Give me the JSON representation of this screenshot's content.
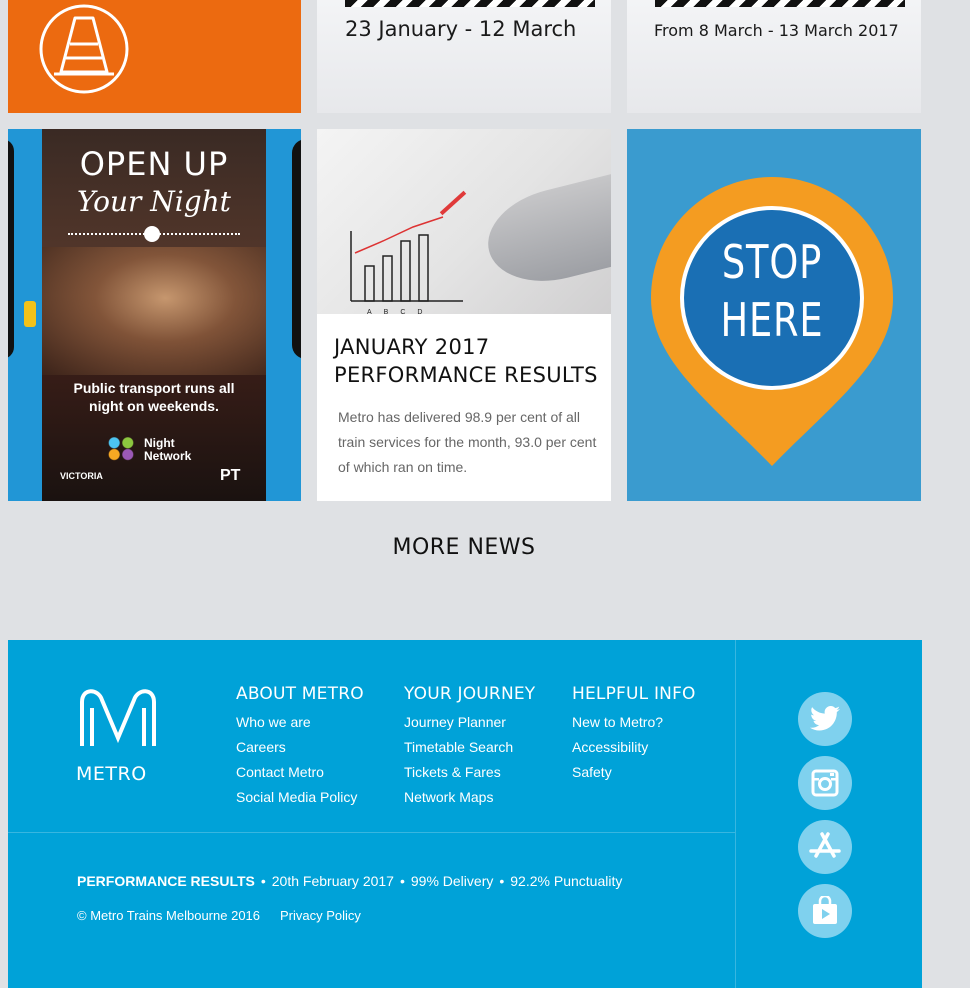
{
  "tiles": {
    "closure_a": {
      "dates": "23 January - 12 March"
    },
    "closure_b": {
      "dates": "From 8 March - 13 March 2017"
    },
    "night_network": {
      "headline_line1": "OPEN UP",
      "headline_line2": "Your Night",
      "tagline": "Public transport runs all night on weekends.",
      "badge": "Night Network",
      "victoria": "VICTORIA",
      "ptv": "PT"
    },
    "performance": {
      "title_line1": "JANUARY 2017",
      "title_line2": "PERFORMANCE RESULTS",
      "body": "Metro has delivered 98.9 per cent of all train services for the month, 93.0 per cent of which ran on time.",
      "chart_labels": [
        "A",
        "B",
        "C",
        "D"
      ]
    },
    "stop_here": {
      "line1": "STOP",
      "line2": "HERE"
    }
  },
  "more_news_label": "MORE NEWS",
  "footer": {
    "logo_text": "METRO",
    "columns": [
      {
        "heading": "ABOUT METRO",
        "links": [
          "Who we are",
          "Careers",
          "Contact Metro",
          "Social Media Policy"
        ]
      },
      {
        "heading": "YOUR JOURNEY",
        "links": [
          "Journey Planner",
          "Timetable Search",
          "Tickets & Fares",
          "Network Maps"
        ]
      },
      {
        "heading": "HELPFUL INFO",
        "links": [
          "New to Metro?",
          "Accessibility",
          "Safety"
        ]
      }
    ],
    "performance": {
      "label": "PERFORMANCE RESULTS",
      "date": "20th February 2017",
      "delivery": "99% Delivery",
      "punctuality": "92.2% Punctuality"
    },
    "copyright": "© Metro Trains Melbourne 2016",
    "privacy": "Privacy Policy",
    "social_icons": [
      "twitter-icon",
      "instagram-icon",
      "app-store-icon",
      "google-play-icon"
    ]
  },
  "colors": {
    "orange": "#ec6a10",
    "footer_blue": "#00a2d8",
    "stop_blue": "#1a6fb4",
    "stop_orange": "#f49c21",
    "tile_blue": "#3a9bcf"
  }
}
